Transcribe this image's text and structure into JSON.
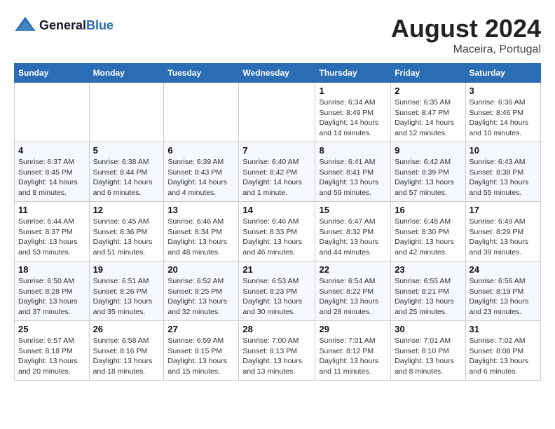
{
  "header": {
    "logo_general": "General",
    "logo_blue": "Blue",
    "month_year": "August 2024",
    "location": "Maceira, Portugal"
  },
  "weekdays": [
    "Sunday",
    "Monday",
    "Tuesday",
    "Wednesday",
    "Thursday",
    "Friday",
    "Saturday"
  ],
  "weeks": [
    [
      {
        "day": "",
        "text": ""
      },
      {
        "day": "",
        "text": ""
      },
      {
        "day": "",
        "text": ""
      },
      {
        "day": "",
        "text": ""
      },
      {
        "day": "1",
        "text": "Sunrise: 6:34 AM\nSunset: 8:49 PM\nDaylight: 14 hours and 14 minutes."
      },
      {
        "day": "2",
        "text": "Sunrise: 6:35 AM\nSunset: 8:47 PM\nDaylight: 14 hours and 12 minutes."
      },
      {
        "day": "3",
        "text": "Sunrise: 6:36 AM\nSunset: 8:46 PM\nDaylight: 14 hours and 10 minutes."
      }
    ],
    [
      {
        "day": "4",
        "text": "Sunrise: 6:37 AM\nSunset: 8:45 PM\nDaylight: 14 hours and 8 minutes."
      },
      {
        "day": "5",
        "text": "Sunrise: 6:38 AM\nSunset: 8:44 PM\nDaylight: 14 hours and 6 minutes."
      },
      {
        "day": "6",
        "text": "Sunrise: 6:39 AM\nSunset: 8:43 PM\nDaylight: 14 hours and 4 minutes."
      },
      {
        "day": "7",
        "text": "Sunrise: 6:40 AM\nSunset: 8:42 PM\nDaylight: 14 hours and 1 minute."
      },
      {
        "day": "8",
        "text": "Sunrise: 6:41 AM\nSunset: 8:41 PM\nDaylight: 13 hours and 59 minutes."
      },
      {
        "day": "9",
        "text": "Sunrise: 6:42 AM\nSunset: 8:39 PM\nDaylight: 13 hours and 57 minutes."
      },
      {
        "day": "10",
        "text": "Sunrise: 6:43 AM\nSunset: 8:38 PM\nDaylight: 13 hours and 55 minutes."
      }
    ],
    [
      {
        "day": "11",
        "text": "Sunrise: 6:44 AM\nSunset: 8:37 PM\nDaylight: 13 hours and 53 minutes."
      },
      {
        "day": "12",
        "text": "Sunrise: 6:45 AM\nSunset: 8:36 PM\nDaylight: 13 hours and 51 minutes."
      },
      {
        "day": "13",
        "text": "Sunrise: 6:46 AM\nSunset: 8:34 PM\nDaylight: 13 hours and 48 minutes."
      },
      {
        "day": "14",
        "text": "Sunrise: 6:46 AM\nSunset: 8:33 PM\nDaylight: 13 hours and 46 minutes."
      },
      {
        "day": "15",
        "text": "Sunrise: 6:47 AM\nSunset: 8:32 PM\nDaylight: 13 hours and 44 minutes."
      },
      {
        "day": "16",
        "text": "Sunrise: 6:48 AM\nSunset: 8:30 PM\nDaylight: 13 hours and 42 minutes."
      },
      {
        "day": "17",
        "text": "Sunrise: 6:49 AM\nSunset: 8:29 PM\nDaylight: 13 hours and 39 minutes."
      }
    ],
    [
      {
        "day": "18",
        "text": "Sunrise: 6:50 AM\nSunset: 8:28 PM\nDaylight: 13 hours and 37 minutes."
      },
      {
        "day": "19",
        "text": "Sunrise: 6:51 AM\nSunset: 8:26 PM\nDaylight: 13 hours and 35 minutes."
      },
      {
        "day": "20",
        "text": "Sunrise: 6:52 AM\nSunset: 8:25 PM\nDaylight: 13 hours and 32 minutes."
      },
      {
        "day": "21",
        "text": "Sunrise: 6:53 AM\nSunset: 8:23 PM\nDaylight: 13 hours and 30 minutes."
      },
      {
        "day": "22",
        "text": "Sunrise: 6:54 AM\nSunset: 8:22 PM\nDaylight: 13 hours and 28 minutes."
      },
      {
        "day": "23",
        "text": "Sunrise: 6:55 AM\nSunset: 8:21 PM\nDaylight: 13 hours and 25 minutes."
      },
      {
        "day": "24",
        "text": "Sunrise: 6:56 AM\nSunset: 8:19 PM\nDaylight: 13 hours and 23 minutes."
      }
    ],
    [
      {
        "day": "25",
        "text": "Sunrise: 6:57 AM\nSunset: 8:18 PM\nDaylight: 13 hours and 20 minutes."
      },
      {
        "day": "26",
        "text": "Sunrise: 6:58 AM\nSunset: 8:16 PM\nDaylight: 13 hours and 18 minutes."
      },
      {
        "day": "27",
        "text": "Sunrise: 6:59 AM\nSunset: 8:15 PM\nDaylight: 13 hours and 15 minutes."
      },
      {
        "day": "28",
        "text": "Sunrise: 7:00 AM\nSunset: 8:13 PM\nDaylight: 13 hours and 13 minutes."
      },
      {
        "day": "29",
        "text": "Sunrise: 7:01 AM\nSunset: 8:12 PM\nDaylight: 13 hours and 11 minutes."
      },
      {
        "day": "30",
        "text": "Sunrise: 7:01 AM\nSunset: 8:10 PM\nDaylight: 13 hours and 8 minutes."
      },
      {
        "day": "31",
        "text": "Sunrise: 7:02 AM\nSunset: 8:08 PM\nDaylight: 13 hours and 6 minutes."
      }
    ]
  ]
}
